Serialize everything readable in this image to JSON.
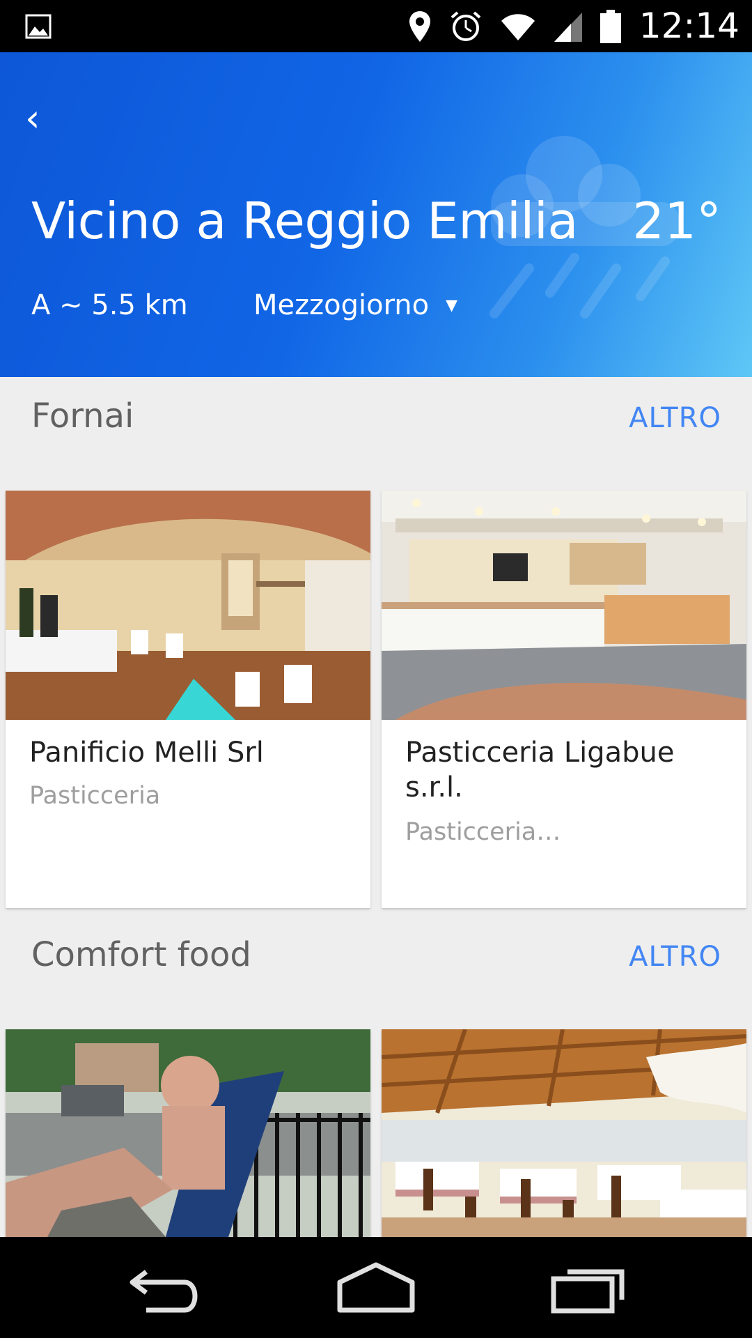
{
  "status_bar": {
    "time": "12:14",
    "icons": [
      "image-icon",
      "location-pin-icon",
      "alarm-icon",
      "wifi-icon",
      "signal-icon",
      "battery-icon"
    ]
  },
  "header": {
    "title": "Vicino a Reggio Emilia",
    "temperature": "21°",
    "distance": "A ~ 5.5 km",
    "time_of_day": "Mezzogiorno",
    "weather_icon": "rain-cloud-icon",
    "gradient_colors": [
      "#0d57d8",
      "#2c90ee",
      "#5fc7f6"
    ]
  },
  "sections": [
    {
      "title": "Fornai",
      "more_label": "ALTRO",
      "cards": [
        {
          "name": "Panificio Melli Srl",
          "category": "Pasticceria"
        },
        {
          "name": "Pasticceria Ligabue s.r.l.",
          "category": "Pasticceria…"
        }
      ]
    },
    {
      "title": "Comfort food",
      "more_label": "ALTRO",
      "cards": [
        {
          "name": "",
          "category": ""
        },
        {
          "name": "",
          "category": ""
        }
      ]
    }
  ],
  "nav_bar": {
    "buttons": [
      "back-icon",
      "home-icon",
      "recents-icon"
    ]
  },
  "colors": {
    "accent": "#4286f4",
    "background": "#eeeeee"
  }
}
